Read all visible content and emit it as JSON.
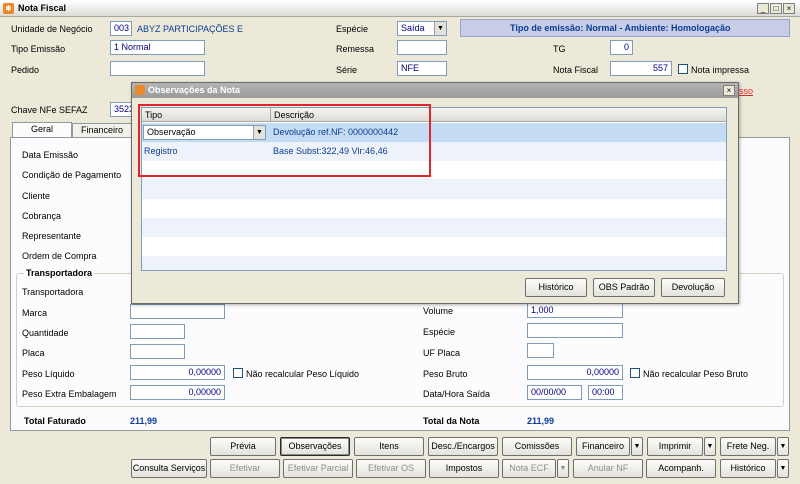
{
  "window": {
    "title": "Nota Fiscal",
    "min": "_",
    "max": "□",
    "close": "×"
  },
  "header": {
    "unidade_label": "Unidade de Negócio",
    "unidade_code": "003",
    "unidade_name": "ABYZ PARTICIPAÇÕES E",
    "especie_label": "Espécie",
    "especie_value": "Saída",
    "emissao_info": "Tipo de emissão: Normal - Ambiente: Homologação",
    "tipo_emissao_label": "Tipo Emissão",
    "tipo_emissao_value": "1 Normal",
    "remessa_label": "Remessa",
    "tg_label": "TG",
    "tg_value": "0",
    "pedido_label": "Pedido",
    "serie_label": "Série",
    "serie_value": "NFE",
    "nota_fiscal_label": "Nota Fiscal",
    "nota_fiscal_value": "557",
    "nota_impressa_label": "Nota impressa",
    "chave_label": "Chave NFe SEFAZ",
    "chave_value": "3523",
    "link_fragment": "sso"
  },
  "tabs": [
    {
      "label": "Geral"
    },
    {
      "label": "Financeiro"
    }
  ],
  "geral": {
    "data_emissao": "Data Emissão",
    "condicao": "Condição de Pagamento",
    "cliente": "Cliente",
    "cobranca": "Cobrança",
    "representante": "Representante",
    "ordem_compra": "Ordem de Compra"
  },
  "transportadora": {
    "group_title": "Transportadora",
    "transportadora_label": "Transportadora",
    "marca_label": "Marca",
    "quantidade_label": "Quantidade",
    "placa_label": "Placa",
    "peso_liquido_label": "Peso Líquido",
    "peso_liquido_value": "0,00000",
    "nao_recalc_liquido": "Não recalcular Peso Líquido",
    "peso_extra_label": "Peso Extra Embalagem",
    "peso_extra_value": "0,00000",
    "volume_label": "Volume",
    "volume_value": "1,000",
    "especie_label": "Espécie",
    "uf_placa_label": "UF Placa",
    "peso_bruto_label": "Peso Bruto",
    "peso_bruto_value": "0,00000",
    "nao_recalc_bruto": "Não recalcular Peso Bruto",
    "data_hora_label": "Data/Hora Saída",
    "data_value": "00/00/00",
    "hora_value": "00:00"
  },
  "totals": {
    "faturado_label": "Total Faturado",
    "faturado_value": "211,99",
    "nota_label": "Total da Nota",
    "nota_value": "211,99"
  },
  "toolbar": {
    "previa": "Prévia",
    "observacoes": "Observações",
    "itens": "Itens",
    "desc_encargos": "Desc./Encargos",
    "comissoes": "Comissões",
    "financeiro": "Financeiro",
    "imprimir": "Imprimir",
    "frete": "Frete Neg.",
    "consulta_servicos": "Consulta Serviços",
    "efetivar": "Efetivar",
    "efetivar_parcial": "Efetivar Parcial",
    "efetivar_os": "Efetivar OS",
    "impostos": "Impostos",
    "nota_ecf": "Nota ECF",
    "anular_nf": "Anular NF",
    "acompanh": "Acompanh.",
    "historico": "Histórico",
    "dropdown": "▼"
  },
  "modal": {
    "title": "Observações da Nota",
    "close": "×",
    "col_tipo": "Tipo",
    "col_descricao": "Descrição",
    "rows": [
      {
        "tipo": "Observação",
        "descricao": "Devolução ref.NF: 0000000442"
      },
      {
        "tipo": "Registro",
        "descricao": "Base Subst:322,49 Vlr:46,46"
      }
    ],
    "btn_historico": "Histórico",
    "btn_obs_padrao": "OBS Padrão",
    "btn_devolucao": "Devolução"
  },
  "colors": {
    "accent_red": "#e0262c",
    "link_blue": "#0b3c96",
    "highlight": "#c3dcf3"
  }
}
